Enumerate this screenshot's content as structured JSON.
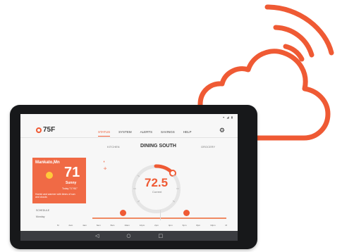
{
  "app": {
    "logo_text": "75F",
    "status_icons": "▾ ◢ ▮"
  },
  "tabs": [
    {
      "label": "STATUS"
    },
    {
      "label": "SYSTEM"
    },
    {
      "label": "ALERTS"
    },
    {
      "label": "SAVINGS"
    },
    {
      "label": "HELP"
    }
  ],
  "room": {
    "previous": "KITCHEN",
    "current": "DINING SOUTH",
    "next": "GROCERY"
  },
  "weather": {
    "city": "Mankato,Mn",
    "temperature": "71",
    "condition": "Sunny",
    "range": "Today 71°/61°",
    "note": "Humid and warmer with times of sun and clouds"
  },
  "thermostat": {
    "current_temperature": "72.5",
    "label": "Current"
  },
  "schedule": {
    "label": "SCHEDULE",
    "day": "Monday"
  },
  "timeline": [
    "M",
    "2am",
    "4am",
    "6am",
    "8am",
    "10am",
    "12pm",
    "2pm",
    "4pm",
    "6pm",
    "8pm",
    "10pm",
    "M"
  ],
  "icons": {
    "settings": "gear-icon",
    "weather": "sun-icon",
    "humidity": "droplet-icon",
    "fan": "fan-icon",
    "back": "back-icon",
    "home": "home-icon",
    "recent": "recent-apps-icon"
  },
  "colors": {
    "accent": "#ef5a34",
    "weather_card": "#f06a45",
    "navigation_bar": "#3b3c41"
  }
}
